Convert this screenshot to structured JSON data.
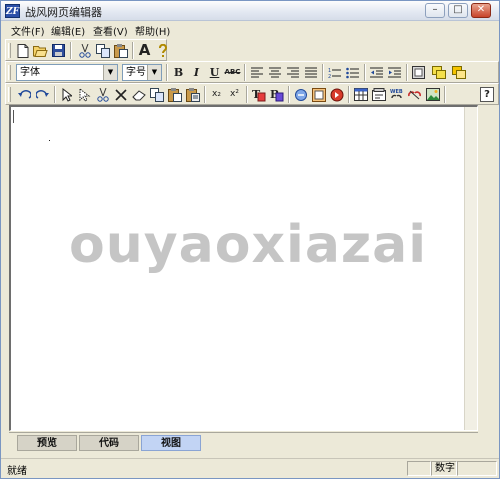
{
  "window": {
    "title": "战风网页编辑器",
    "app_icon_text": "ZF",
    "minimize_glyph": "–",
    "maximize_glyph": "□",
    "close_glyph": "✕"
  },
  "menu": {
    "file": "文件(F)",
    "edit": "编辑(E)",
    "view": "查看(V)",
    "help": "帮助(H)"
  },
  "format_toolbar": {
    "font_value": "字体",
    "font_size_value": "字号",
    "bold": "B",
    "italic": "I",
    "underline": "U",
    "strike": "ABC"
  },
  "insert_toolbar": {
    "subscript": "x₂",
    "superscript": "x²",
    "help": "?"
  },
  "editor": {
    "watermark": "ouyaoxiazai"
  },
  "tabs": {
    "preview": "预览",
    "code": "代码",
    "design": "视图"
  },
  "status": {
    "text": "就绪",
    "numlock": "数字"
  },
  "colors": {
    "accent": "#c2d4f4",
    "chrome": "#ece9d8"
  }
}
